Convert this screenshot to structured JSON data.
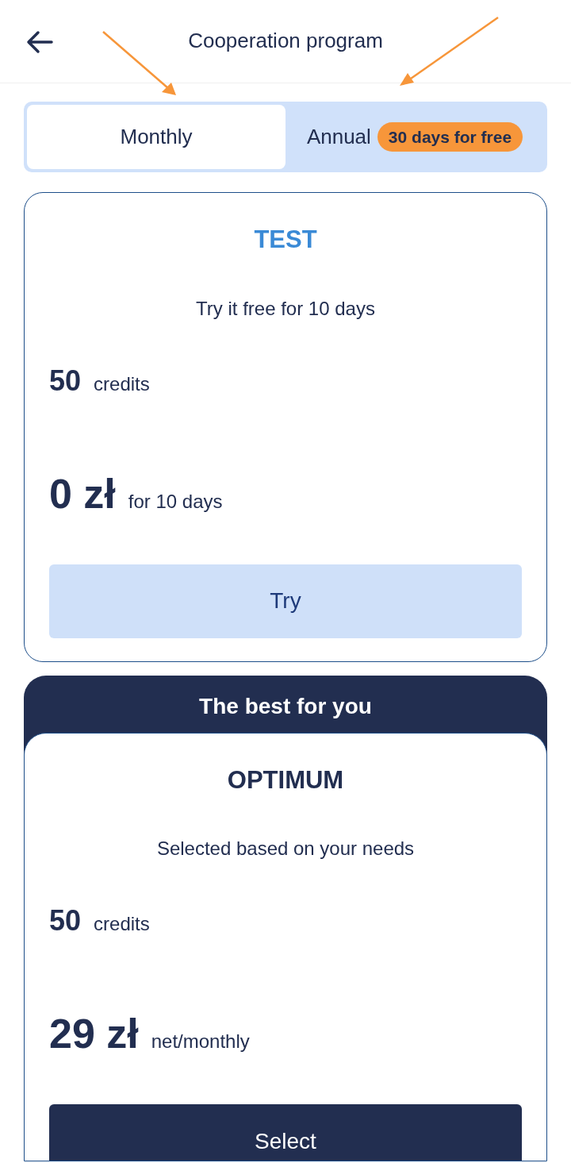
{
  "header": {
    "title": "Cooperation program"
  },
  "billing_tabs": [
    {
      "label": "Monthly",
      "selected": true
    },
    {
      "label": "Annual",
      "selected": false,
      "badge": "30 days for free"
    }
  ],
  "plans": [
    {
      "name": "TEST",
      "featured": false,
      "description": "Try it free for 10 days",
      "credits": "50",
      "credits_label": "credits",
      "price": "0 zł",
      "price_note": "for 10 days",
      "button": "Try"
    },
    {
      "name": "OPTIMUM",
      "featured": true,
      "banner": "The best for you",
      "description": "Selected based on your needs",
      "credits": "50",
      "credits_label": "credits",
      "price": "29 zł",
      "price_note": "net/monthly",
      "button": "Select"
    }
  ]
}
